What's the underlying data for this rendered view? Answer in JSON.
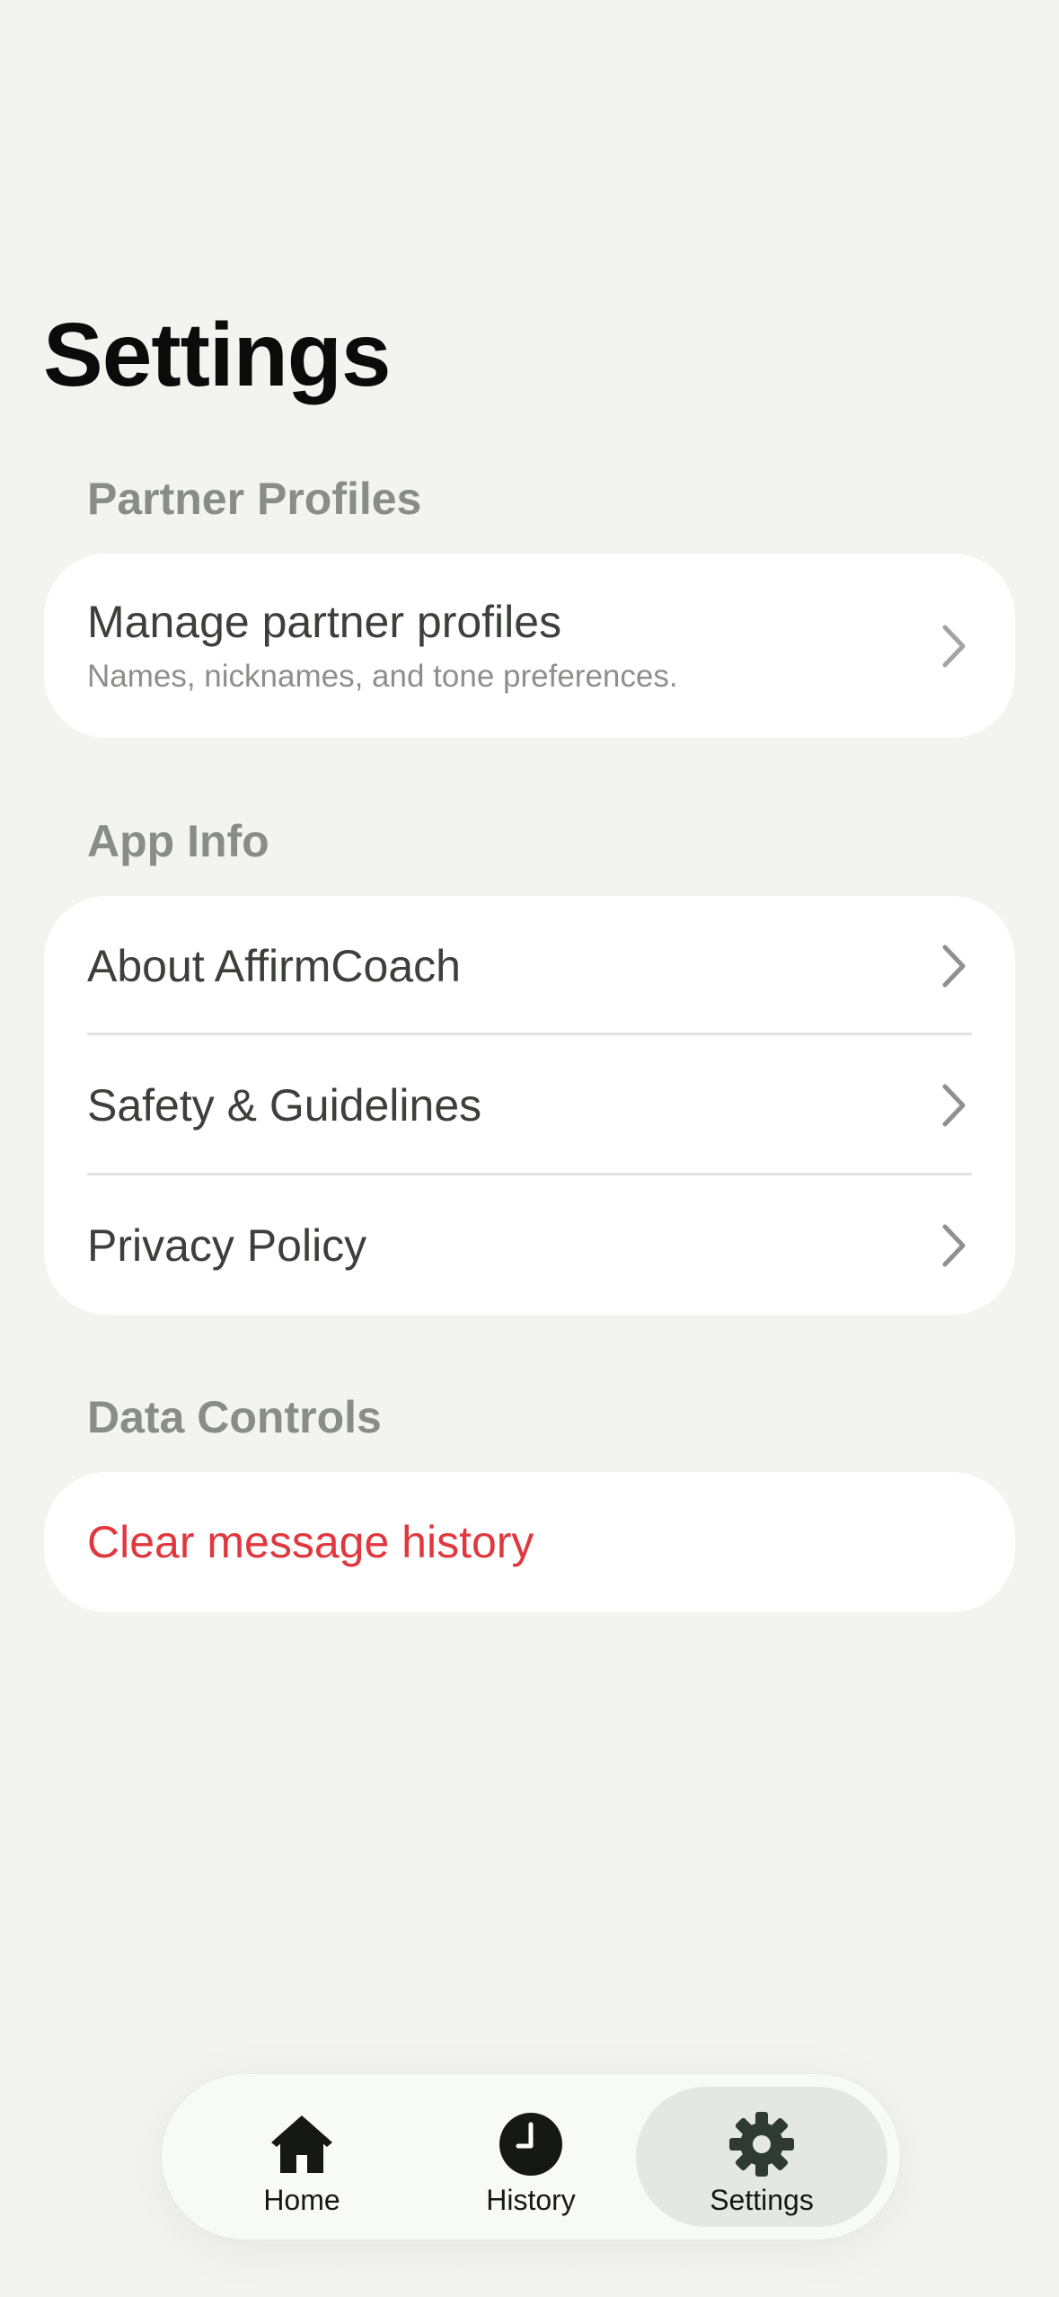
{
  "header": {
    "title": "Settings"
  },
  "sections": {
    "partner_profiles": {
      "header": "Partner Profiles",
      "manage": {
        "label": "Manage partner profiles",
        "subtitle": "Names, nicknames, and tone preferences."
      }
    },
    "app_info": {
      "header": "App Info",
      "items": [
        {
          "label": "About AffirmCoach"
        },
        {
          "label": "Safety & Guidelines"
        },
        {
          "label": "Privacy Policy"
        }
      ]
    },
    "data_controls": {
      "header": "Data Controls",
      "clear_history": {
        "label": "Clear message history"
      }
    }
  },
  "tabbar": {
    "tabs": [
      {
        "label": "Home",
        "icon": "home-icon"
      },
      {
        "label": "History",
        "icon": "clock-icon"
      },
      {
        "label": "Settings",
        "icon": "gear-icon",
        "active": true
      }
    ]
  },
  "colors": {
    "background": "#f3f4f0",
    "card": "#ffffff",
    "section_header": "#8a8c89",
    "danger": "#e0383e",
    "active_tab": "#e5e8e2"
  }
}
